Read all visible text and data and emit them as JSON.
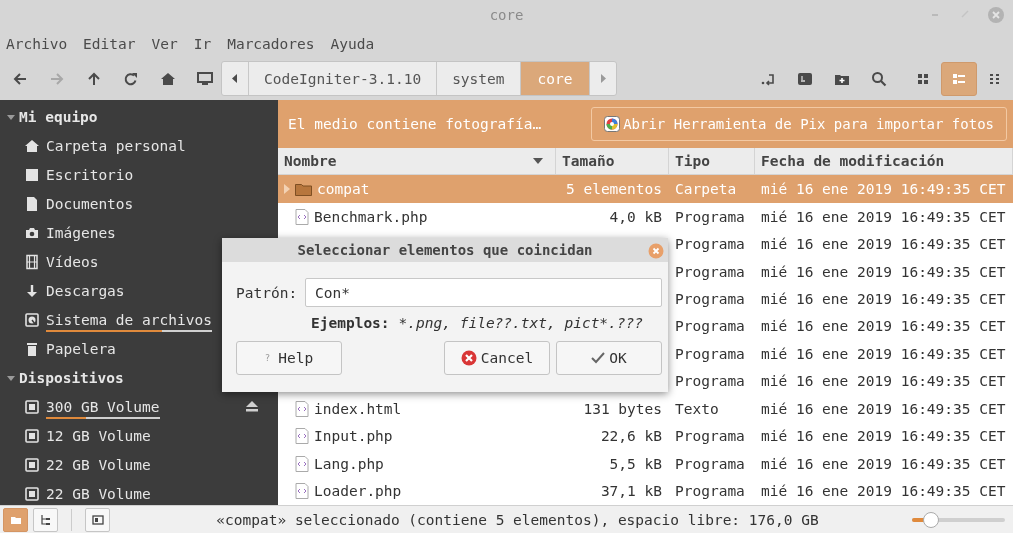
{
  "window": {
    "title": "core",
    "controls": [
      {
        "kind": "minimize"
      },
      {
        "kind": "maximize"
      },
      {
        "kind": "close"
      }
    ]
  },
  "menu": [
    "Archivo",
    "Editar",
    "Ver",
    "Ir",
    "Marcadores",
    "Ayuda"
  ],
  "toolbar": {
    "nav": [
      {
        "kind": "back",
        "disabled": false
      },
      {
        "kind": "forward",
        "disabled": true
      },
      {
        "kind": "up",
        "disabled": false
      },
      {
        "kind": "reload",
        "disabled": false
      },
      {
        "kind": "home",
        "disabled": false
      },
      {
        "kind": "computer",
        "disabled": false
      }
    ],
    "path": [
      {
        "label": "CodeIgniter-3.1.10",
        "selected": false
      },
      {
        "label": "system",
        "selected": false
      },
      {
        "label": "core",
        "selected": true
      }
    ],
    "tools": [
      {
        "kind": "location"
      },
      {
        "kind": "terminal"
      },
      {
        "kind": "new-folder"
      },
      {
        "kind": "search"
      }
    ],
    "views": [
      {
        "kind": "icons",
        "selected": false
      },
      {
        "kind": "list",
        "selected": true
      },
      {
        "kind": "compact",
        "selected": false
      }
    ]
  },
  "sidebar": [
    {
      "title": "Mi equipo",
      "expanded": true,
      "items": [
        {
          "label": "Carpeta personal",
          "kind": "home"
        },
        {
          "label": "Escritorio",
          "kind": "desktop"
        },
        {
          "label": "Documentos",
          "kind": "document"
        },
        {
          "label": "Imágenes",
          "kind": "camera"
        },
        {
          "label": "Vídeos",
          "kind": "film"
        },
        {
          "label": "Descargas",
          "kind": "download"
        },
        {
          "label": "Sistema de archivos",
          "kind": "drive",
          "level": 0.7
        },
        {
          "label": "Papelera",
          "kind": "trash"
        }
      ]
    },
    {
      "title": "Dispositivos",
      "expanded": true,
      "items": [
        {
          "label": "300 GB Volume",
          "kind": "chip",
          "level": 0.35,
          "eject": true
        },
        {
          "label": "12 GB Volume",
          "kind": "chip",
          "eject": false
        },
        {
          "label": "22 GB Volume",
          "kind": "chip",
          "eject": false
        },
        {
          "label": "22 GB Volume",
          "kind": "chip",
          "eject": false
        }
      ]
    }
  ],
  "infobar": {
    "message": "El medio contiene fotografía…",
    "button": "Abrir Herramienta de Pix para importar fotos"
  },
  "table": {
    "columns": [
      {
        "label": "Nombre",
        "sorted": true
      },
      {
        "label": "Tamaño",
        "sorted": false
      },
      {
        "label": "Tipo",
        "sorted": false
      },
      {
        "label": "Fecha de modificación",
        "sorted": false
      }
    ],
    "rows": [
      {
        "kind": "folder",
        "name": "compat",
        "size": "5 elementos",
        "type": "Carpeta",
        "modified": "mié 16 ene 2019 16:49:35 CET",
        "selected": true
      },
      {
        "kind": "file",
        "name": "Benchmark.php",
        "size": "4,0 kB",
        "type": "Programa",
        "modified": "mié 16 ene 2019 16:49:35 CET",
        "selected": false
      },
      {
        "type": "Programa",
        "modified": "mié 16 ene 2019 16:49:35 CET",
        "selected": false
      },
      {
        "type": "Programa",
        "modified": "mié 16 ene 2019 16:49:35 CET",
        "selected": false
      },
      {
        "type": "Programa",
        "modified": "mié 16 ene 2019 16:49:35 CET",
        "selected": false
      },
      {
        "type": "Programa",
        "modified": "mié 16 ene 2019 16:49:35 CET",
        "selected": false
      },
      {
        "type": "Programa",
        "modified": "mié 16 ene 2019 16:49:35 CET",
        "selected": false
      },
      {
        "type": "Programa",
        "modified": "mié 16 ene 2019 16:49:35 CET",
        "selected": false
      },
      {
        "kind": "file",
        "name": "index.html",
        "size": "131 bytes",
        "type": "Texto",
        "modified": "mié 16 ene 2019 16:49:35 CET",
        "selected": false
      },
      {
        "kind": "file",
        "name": "Input.php",
        "size": "22,6 kB",
        "type": "Programa",
        "modified": "mié 16 ene 2019 16:49:35 CET",
        "selected": false
      },
      {
        "kind": "file",
        "name": "Lang.php",
        "size": "5,5 kB",
        "type": "Programa",
        "modified": "mié 16 ene 2019 16:49:35 CET",
        "selected": false
      },
      {
        "kind": "file",
        "name": "Loader.php",
        "size": "37,1 kB",
        "type": "Programa",
        "modified": "mié 16 ene 2019 16:49:35 CET",
        "selected": false
      }
    ]
  },
  "dialog": {
    "title": "Seleccionar elementos que coincidan",
    "label": "Patrón:",
    "value": "Con*",
    "hint_label": "Ejemplos:",
    "hint_examples": "*.png, file??.txt, pict*.???",
    "buttons": [
      {
        "kind": "help",
        "icon": "?",
        "label": "Help"
      },
      {
        "kind": "cancel",
        "label": "Cancel"
      },
      {
        "kind": "ok",
        "label": "OK"
      }
    ]
  },
  "status": {
    "panes": [
      {
        "kind": "places",
        "selected": true
      },
      {
        "kind": "tree",
        "selected": false
      },
      {
        "kind": "sidebar",
        "selected": false
      }
    ],
    "text": "«compat» seleccionado (contiene 5 elementos), espacio libre: 176,0 GB",
    "zoom": {
      "level": 0.2
    }
  }
}
